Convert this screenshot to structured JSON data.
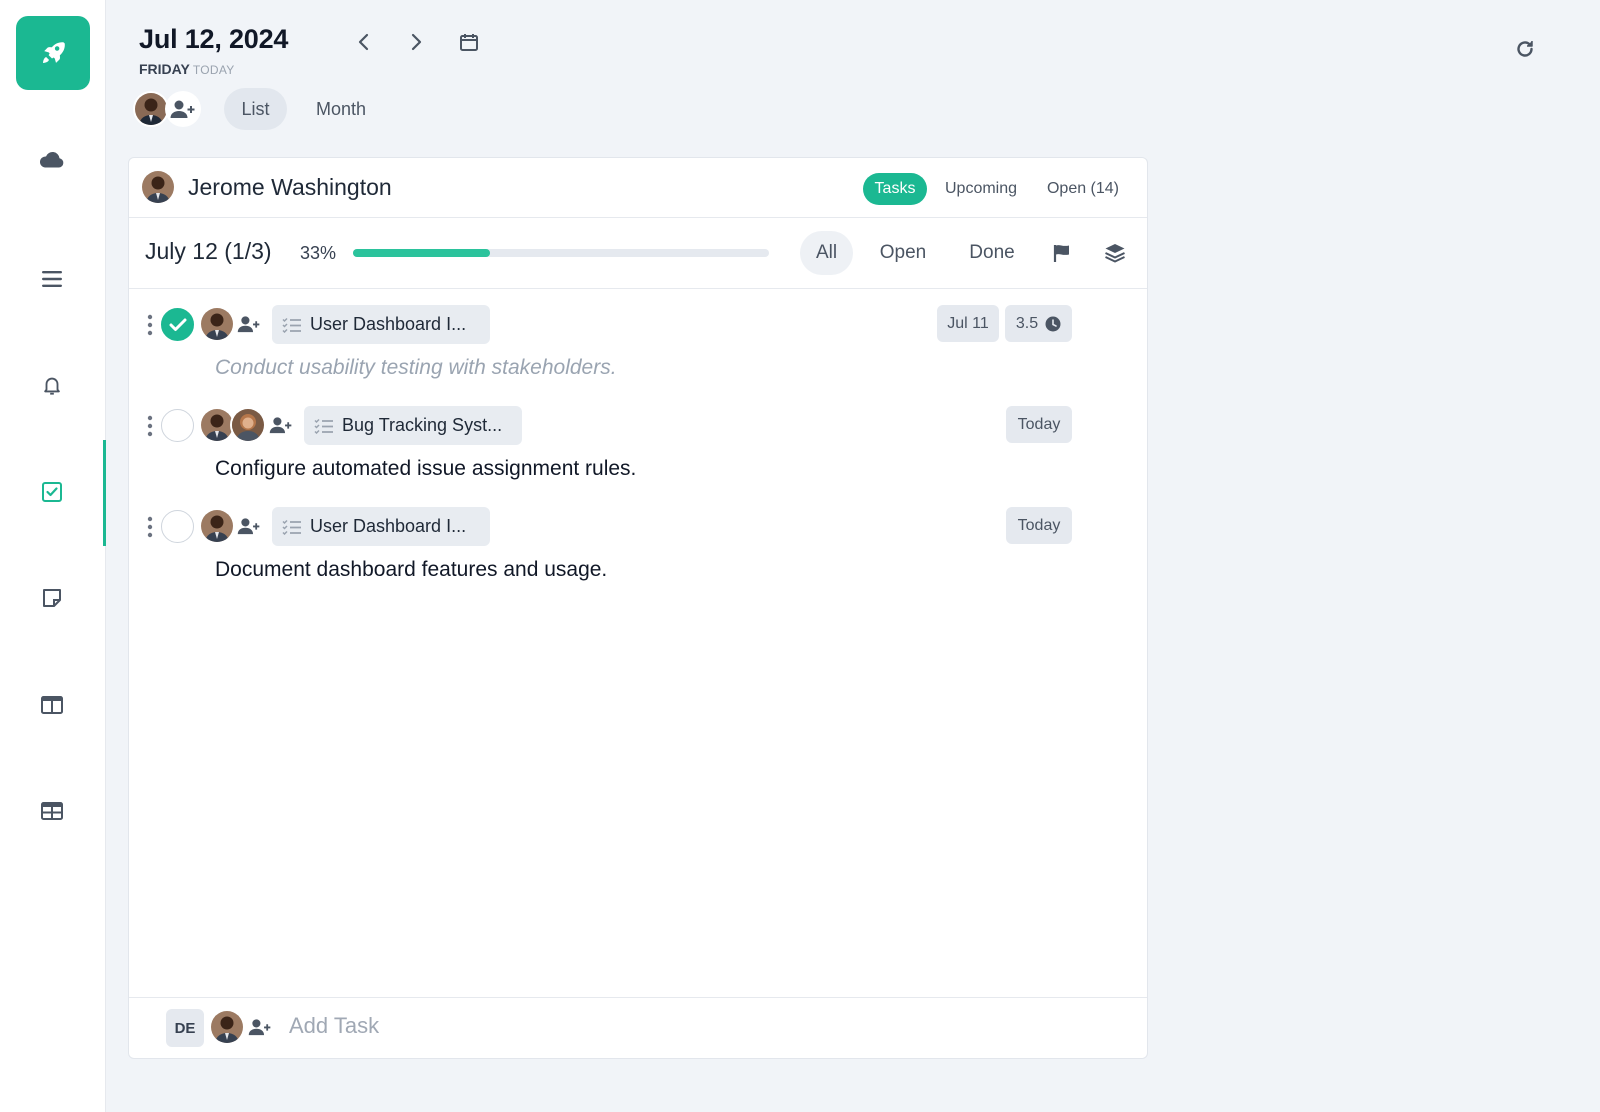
{
  "header": {
    "date": "Jul 12, 2024",
    "weekday": "FRIDAY",
    "today_label": "TODAY",
    "views": [
      {
        "label": "List",
        "active": true
      },
      {
        "label": "Month",
        "active": false
      }
    ]
  },
  "sidebar": {
    "accent": "#1bb892",
    "items": [
      {
        "icon": "cloud-icon"
      },
      {
        "icon": "menu-icon"
      },
      {
        "icon": "bell-icon"
      },
      {
        "icon": "checkbox-icon",
        "active": true
      },
      {
        "icon": "note-icon"
      },
      {
        "icon": "columns-icon"
      },
      {
        "icon": "table-icon"
      }
    ]
  },
  "card": {
    "user_name": "Jerome Washington",
    "tabs": [
      {
        "label": "Tasks",
        "active": true
      },
      {
        "label": "Upcoming",
        "active": false
      },
      {
        "label": "Open (14)",
        "active": false
      }
    ],
    "progress": {
      "label": "July 12 (1/3)",
      "percent_label": "33%",
      "fraction": 0.33
    },
    "filters": [
      {
        "label": "All",
        "active": true
      },
      {
        "label": "Open",
        "active": false
      },
      {
        "label": "Done",
        "active": false
      }
    ]
  },
  "tasks": [
    {
      "done": true,
      "project": "User Dashboard I...",
      "date": "Jul 11",
      "hours": "3.5",
      "description": "Conduct usability testing with stakeholders."
    },
    {
      "done": false,
      "project": "Bug Tracking Syst...",
      "date": "Today",
      "description": "Configure automated issue assignment rules."
    },
    {
      "done": false,
      "project": "User Dashboard I...",
      "date": "Today",
      "description": "Document dashboard features and usage."
    }
  ],
  "footer": {
    "initials": "DE",
    "add_placeholder": "Add Task"
  }
}
